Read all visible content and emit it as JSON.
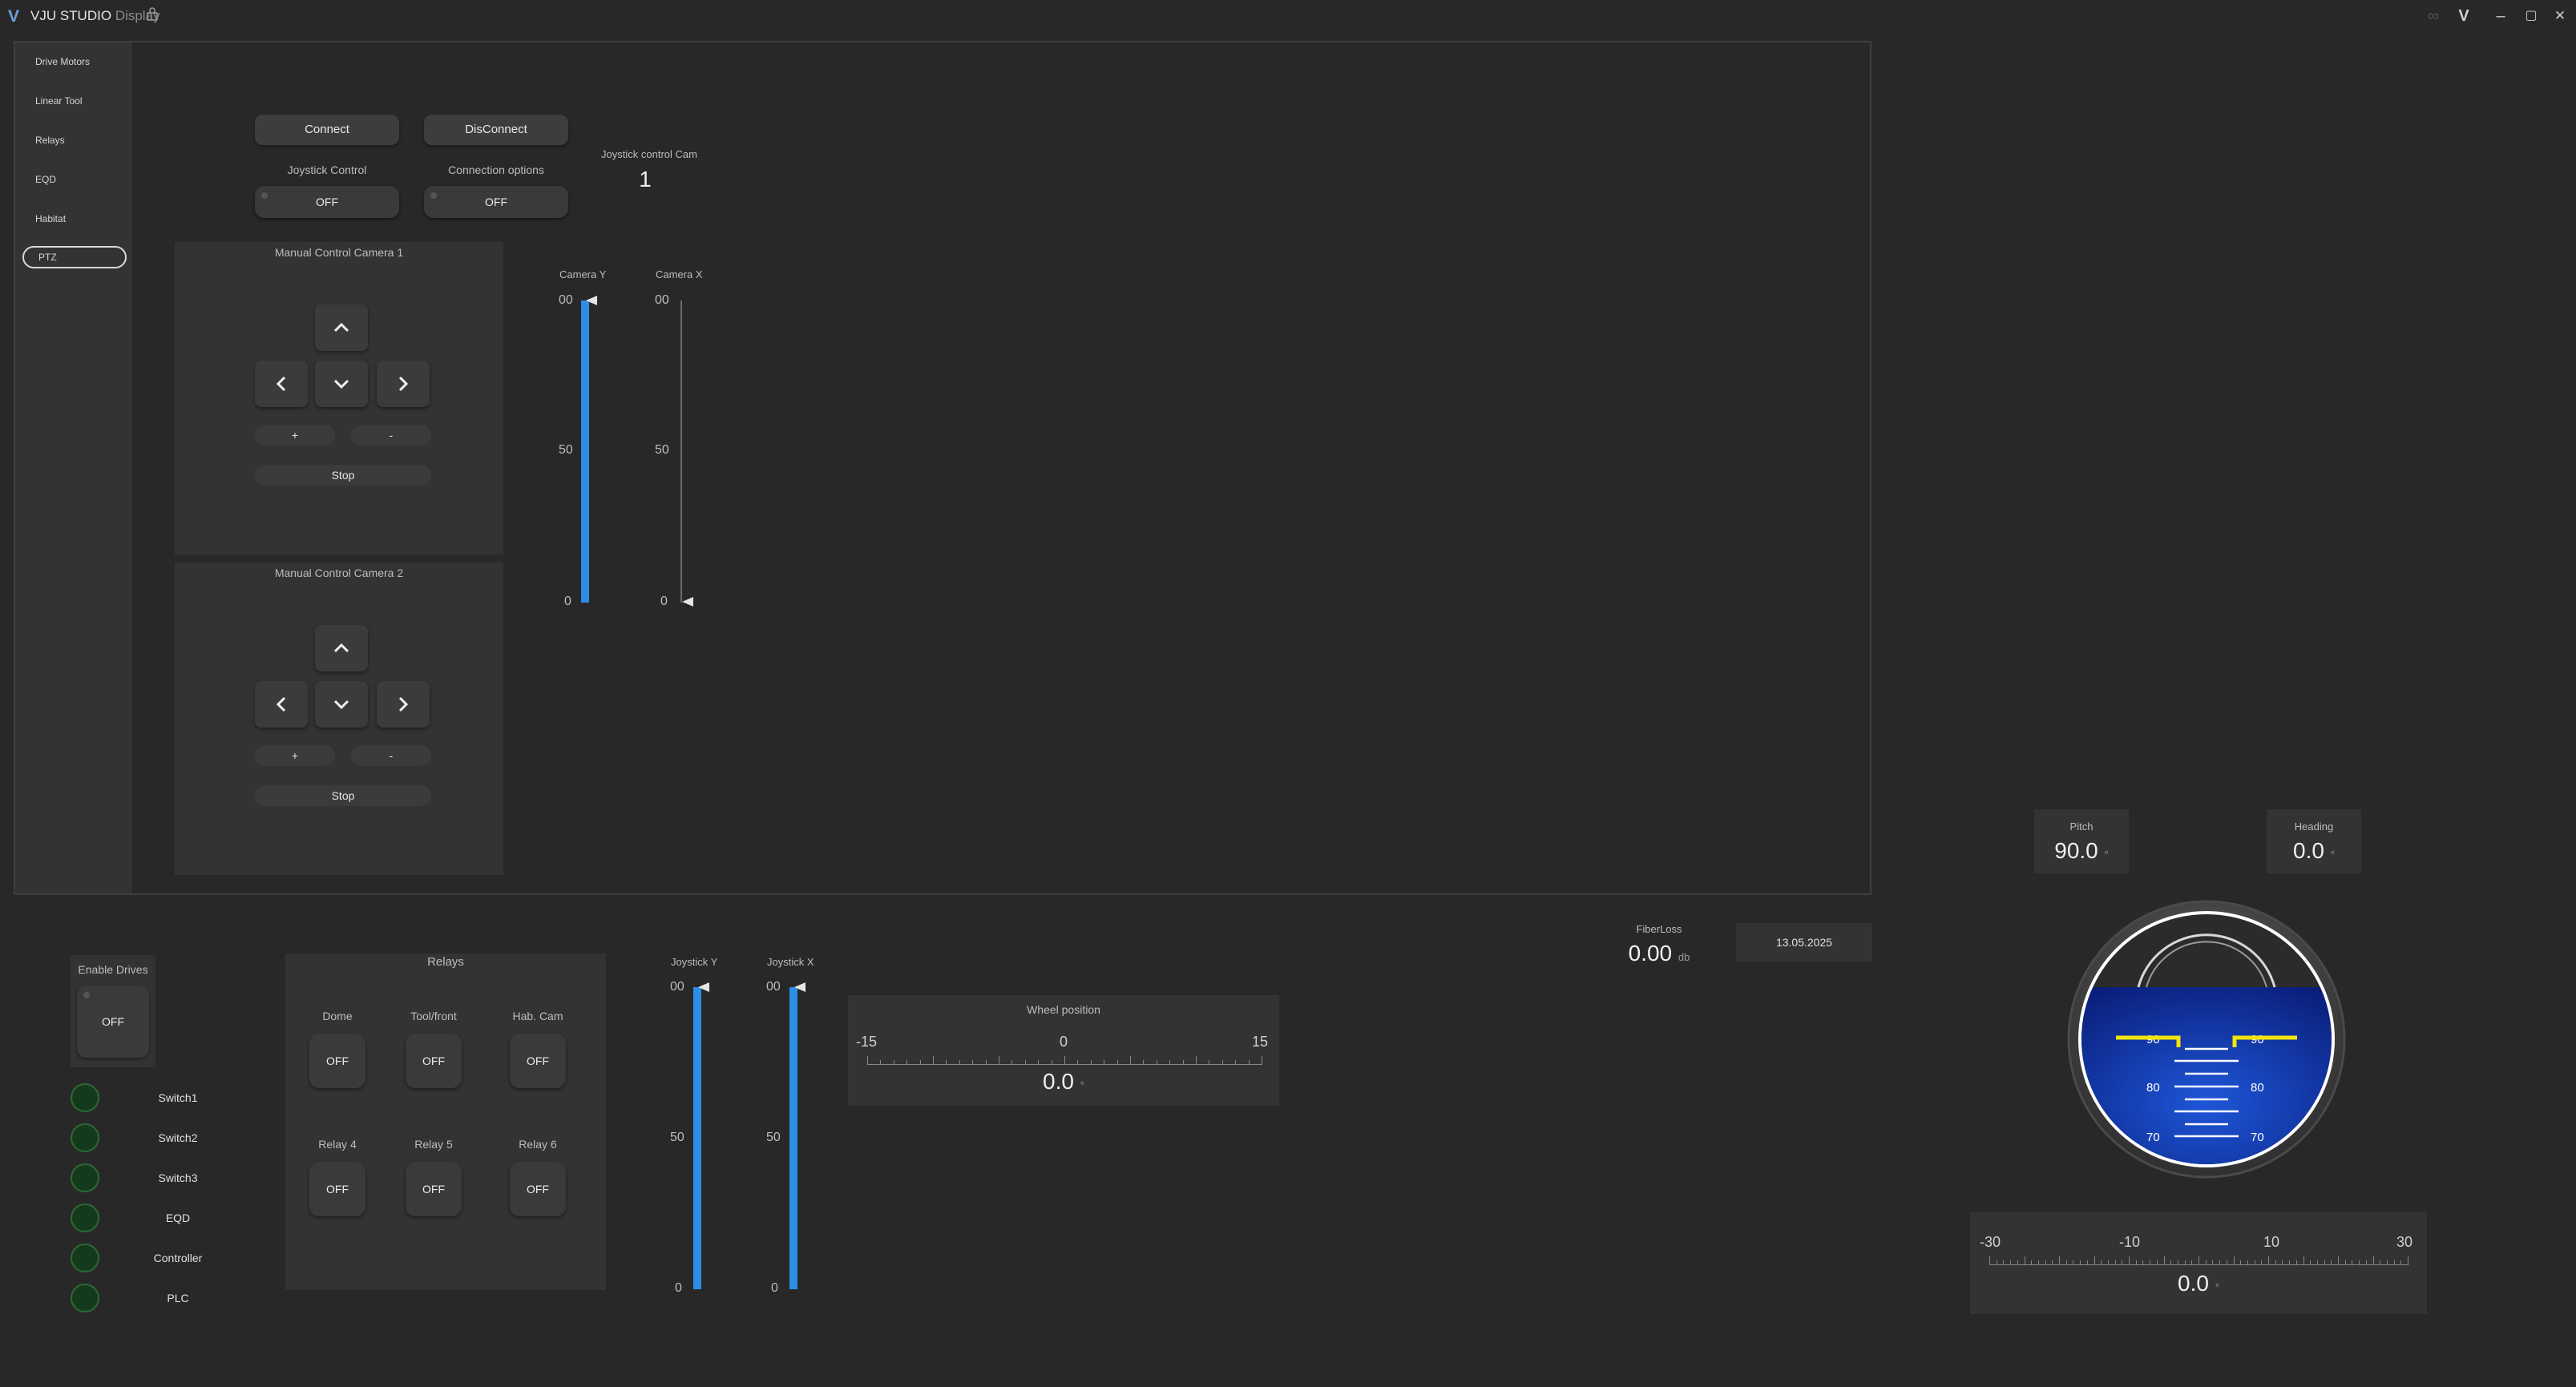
{
  "window": {
    "logo": "V",
    "title": "VJU STUDIO",
    "subtitle": "Display",
    "lock_icon": "lock-icon",
    "controls": {
      "link": "∞",
      "brand": "V",
      "minimize": "–",
      "maximize": "▢",
      "close": "✕"
    }
  },
  "sidebar": {
    "items": [
      {
        "label": "Drive Motors"
      },
      {
        "label": "Linear Tool"
      },
      {
        "label": "Relays"
      },
      {
        "label": "EQD"
      },
      {
        "label": "Habitat"
      },
      {
        "label": "PTZ"
      }
    ],
    "active": "PTZ"
  },
  "ptz": {
    "connect_label": "Connect",
    "disconnect_label": "DisConnect",
    "joystick_control_label": "Joystick Control",
    "joystick_control_state": "OFF",
    "connection_options_label": "Connection options",
    "connection_options_state": "OFF",
    "joystick_cam_label": "Joystick control Cam",
    "joystick_cam_value": "1",
    "camera1": {
      "title": "Manual Control Camera 1",
      "plus": "+",
      "minus": "-",
      "stop": "Stop"
    },
    "camera2": {
      "title": "Manual Control Camera 2",
      "plus": "+",
      "minus": "-",
      "stop": "Stop"
    },
    "camera_y": {
      "label": "Camera Y",
      "ticks": [
        "00",
        "50",
        "0"
      ],
      "value_fraction": 1.0
    },
    "camera_x": {
      "label": "Camera X",
      "ticks": [
        "00",
        "50",
        "0"
      ],
      "value_fraction": 0.0
    }
  },
  "bottom": {
    "enable_drives": {
      "label": "Enable Drives",
      "state": "OFF"
    },
    "leds": [
      "Switch1",
      "Switch2",
      "Switch3",
      "EQD",
      "Controller",
      "PLC"
    ],
    "relays": {
      "title": "Relays",
      "items": [
        {
          "label": "Dome",
          "state": "OFF"
        },
        {
          "label": "Tool/front",
          "state": "OFF"
        },
        {
          "label": "Hab. Cam",
          "state": "OFF"
        },
        {
          "label": "Relay 4",
          "state": "OFF"
        },
        {
          "label": "Relay 5",
          "state": "OFF"
        },
        {
          "label": "Relay 6",
          "state": "OFF"
        }
      ]
    },
    "joystick_y": {
      "label": "Joystick Y",
      "ticks": [
        "00",
        "50",
        "0"
      ],
      "value_fraction": 1.0
    },
    "joystick_x": {
      "label": "Joystick X",
      "ticks": [
        "00",
        "50",
        "0"
      ],
      "value_fraction": 1.0
    },
    "wheel_position": {
      "title": "Wheel position",
      "min": "-15",
      "mid": "0",
      "max": "15",
      "value": "0.0",
      "unit": "°"
    },
    "fiberloss": {
      "label": "FiberLoss",
      "value": "0.00",
      "unit": "db"
    },
    "date": "13.05.2025"
  },
  "instruments": {
    "pitch": {
      "label": "Pitch",
      "value": "90.0",
      "unit": "°"
    },
    "heading": {
      "label": "Heading",
      "value": "0.0",
      "unit": "°"
    },
    "horizon_marks": [
      "90",
      "80",
      "70"
    ],
    "roll": {
      "ticks": [
        "-30",
        "-10",
        "10",
        "30"
      ],
      "value": "0.0",
      "unit": "°"
    }
  },
  "colors": {
    "accent_blue": "#2b8fe6",
    "horizon_yellow": "#f2e40c",
    "led_green": "#153a1b",
    "background": "#282828"
  }
}
